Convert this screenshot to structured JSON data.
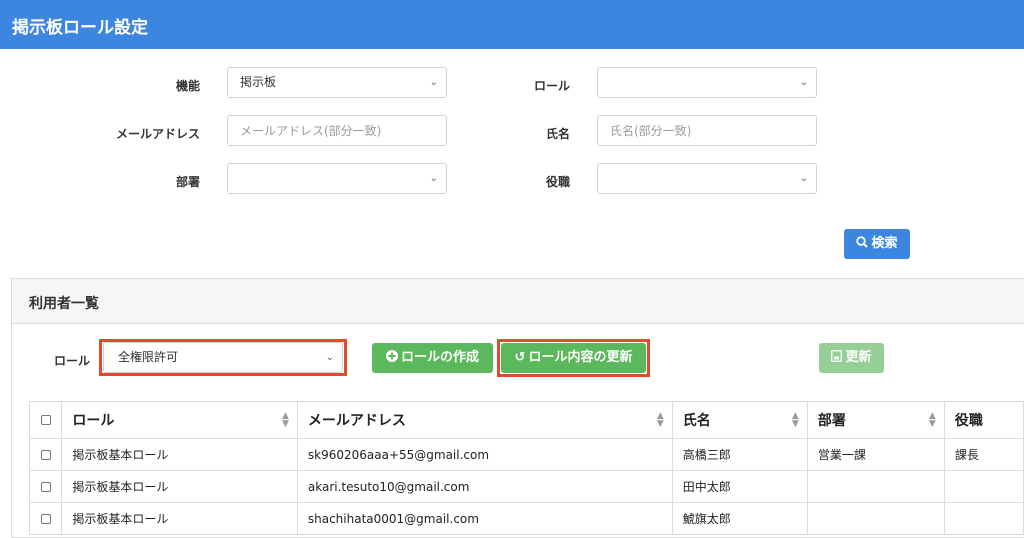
{
  "header": {
    "title": "掲示板ロール設定"
  },
  "filters": {
    "function_label": "機能",
    "function_value": "掲示板",
    "role_label": "ロール",
    "role_value": "",
    "email_label": "メールアドレス",
    "email_placeholder": "メールアドレス(部分一致)",
    "name_label": "氏名",
    "name_placeholder": "氏名(部分一致)",
    "dept_label": "部署",
    "dept_value": "",
    "position_label": "役職",
    "position_value": "",
    "search_label": "検索"
  },
  "userlist": {
    "title": "利用者一覧",
    "role_label": "ロール",
    "role_value": "全権限許可",
    "create_label": "ロールの作成",
    "update_role_label": "ロール内容の更新",
    "update_label": "更新"
  },
  "table": {
    "headers": [
      "ロール",
      "メールアドレス",
      "氏名",
      "部署",
      "役職"
    ],
    "rows": [
      [
        "掲示板基本ロール",
        "sk960206aaa+55@gmail.com",
        "高橋三郎",
        "営業一課",
        "課長"
      ],
      [
        "掲示板基本ロール",
        "akari.tesuto10@gmail.com",
        "田中太郎",
        "",
        ""
      ],
      [
        "掲示板基本ロール",
        "shachihata0001@gmail.com",
        "鯱旗太郎",
        "",
        ""
      ]
    ]
  },
  "icons": {
    "search": "search-icon",
    "plus": "plus-circle-icon",
    "undo": "undo-icon",
    "save": "save-icon",
    "sort": "sort-icon"
  },
  "colors": {
    "header": "#3d86e0",
    "primary": "#3d86e0",
    "success": "#5cb85c",
    "highlight": "#e2492d"
  }
}
